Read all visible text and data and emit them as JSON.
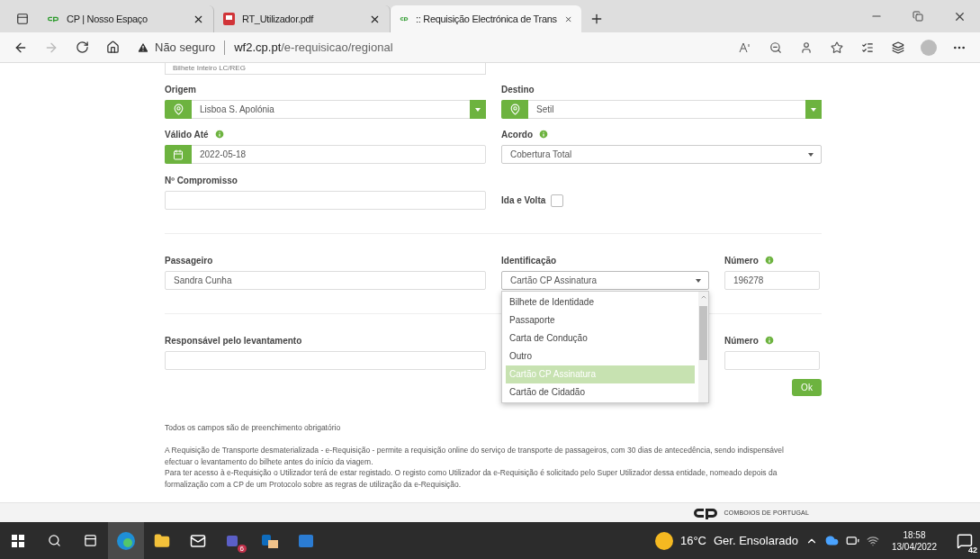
{
  "browser": {
    "tabs": [
      {
        "title": "CP | Nosso Espaço",
        "kind": "cp",
        "selected": false
      },
      {
        "title": "RT_Utilizador.pdf",
        "kind": "pdf",
        "selected": false
      },
      {
        "title": ":: Requisição Electrónica de Trans",
        "kind": "cp",
        "selected": true
      }
    ],
    "security": "Não seguro",
    "url_host": "wf2.cp.pt",
    "url_path": "/e-requisicao/regional"
  },
  "form": {
    "top_field": "Bilhete Inteiro LC/REG",
    "origem": {
      "label": "Origem",
      "value": "Lisboa S. Apolónia"
    },
    "destino": {
      "label": "Destino",
      "value": "Setil"
    },
    "valido": {
      "label": "Válido Até",
      "info": true,
      "value": "2022-05-18"
    },
    "acordo": {
      "label": "Acordo",
      "info": true,
      "value": "Cobertura Total"
    },
    "compromisso": {
      "label": "Nº Compromisso"
    },
    "ida_volta": {
      "label": "Ida e Volta",
      "checked": false
    },
    "passageiro": {
      "label": "Passageiro",
      "value": "Sandra Cunha"
    },
    "identificacao": {
      "label": "Identificação",
      "value": "Cartão CP Assinatura",
      "expanded": true,
      "options": [
        {
          "label": "Bilhete de Identidade",
          "selected": false
        },
        {
          "label": "Passaporte",
          "selected": false
        },
        {
          "label": "Carta de Condução",
          "selected": false
        },
        {
          "label": "Outro",
          "selected": false
        },
        {
          "label": "Cartão CP Assinatura",
          "selected": true
        },
        {
          "label": "Cartão de Cidadão",
          "selected": false
        }
      ]
    },
    "numero": {
      "label": "Número",
      "info": true,
      "value": "196278"
    },
    "responsavel": {
      "label": "Responsável pelo levantamento"
    },
    "numero_responsavel": {
      "label": "Número",
      "info": true
    },
    "ok_button": "Ok",
    "note": "Todos os campos são de preenchimento obrigatório",
    "paragraphs": [
      "A Requisição de Transporte desmaterializada - e-Requisição - permite a requisição online do serviço de transporte de passageiros, com 30 dias de antecedência, sendo indispensável efectuar o levantamento do bilhete antes do início da viagem.",
      "Para ter acesso à e-Requisição o Utilizador terá de estar registado. O registo como Utilizador da e-Requisição é solicitado pelo Super Utilizador dessa entidade, nomeado depois da formalização com a CP de um Protocolo sobre as regras de utilização da e-Requisição."
    ]
  },
  "footer": {
    "logo_text": "COMBOIOS DE PORTUGAL"
  },
  "taskbar": {
    "teams_badge": "6",
    "temperature": "16°C",
    "weather": "Ger. Ensolarado",
    "time": "18:58",
    "date": "13/04/2022",
    "notifications": "42"
  }
}
